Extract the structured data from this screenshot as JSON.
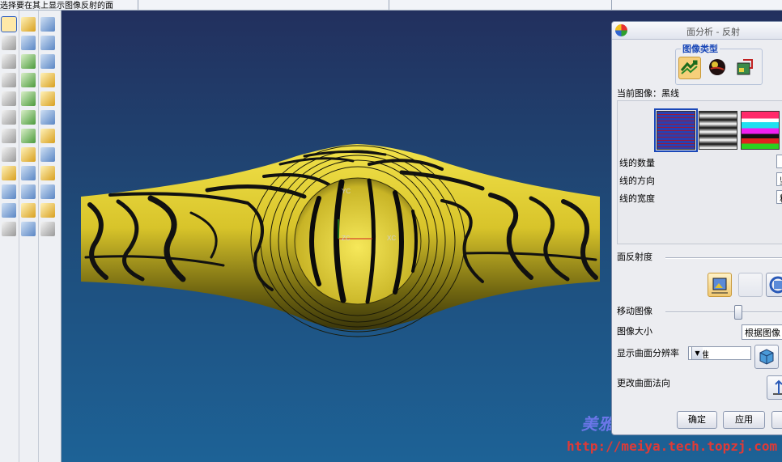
{
  "status": {
    "prompt": "选择要在其上显示图像反射的面"
  },
  "dialog": {
    "title": "面分析 - 反射",
    "image_type_group": "图像类型",
    "current_image_label": "当前图像：黑线",
    "num_lines_label": "线的数量",
    "line_direction_label": "线的方向",
    "line_direction_value": "竖",
    "line_width_label": "线的宽度",
    "line_width_value": "粗",
    "reflectivity_label": "面反射度",
    "move_image_label": "移动图像",
    "image_size_label": "图像大小",
    "image_size_value": "根据图像",
    "resolution_label": "显示曲面分辨率",
    "resolution_value": "标准",
    "reverse_normal_label": "更改曲面法向",
    "ok": "确定",
    "apply": "应用",
    "move_image_fraction": 0.62
  },
  "viewport": {
    "axis_x": "XC",
    "axis_y": "YC",
    "axis_z": "ZC"
  },
  "watermark": {
    "line1": "美雅Pro/E中文论坛",
    "line2": "http://meiya.tech.topzj.com"
  },
  "colors": {
    "surface": "#e0cf30",
    "background_top": "#22305e",
    "background_bottom": "#1d6296",
    "accent": "#1a48b8"
  }
}
